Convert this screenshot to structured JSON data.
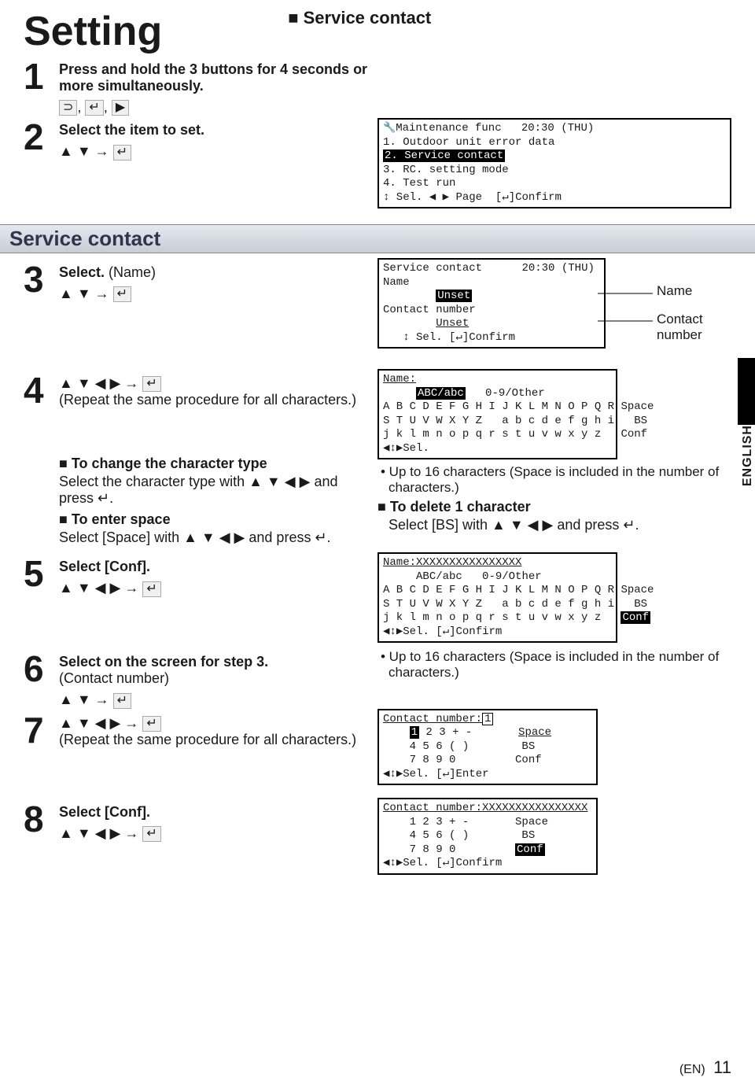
{
  "page": {
    "title": "Setting",
    "section_header": "■ Service contact",
    "section_bar": "Service contact",
    "lang_tab": "ENGLISH",
    "footer_lang": "(EN)",
    "footer_page": "11"
  },
  "steps": {
    "s1": {
      "num": "1",
      "text": "Press and hold the 3 buttons for 4 seconds or more simultaneously.",
      "icons": "⊃, ↵, ▶"
    },
    "s2": {
      "num": "2",
      "text": "Select the item to set.",
      "icons": "▲ ▼ → ↵"
    },
    "s3": {
      "num": "3",
      "text_a": "Select. ",
      "text_b": "(Name)",
      "icons": "▲ ▼ → ↵"
    },
    "s4": {
      "num": "4",
      "icons": "▲ ▼ ◀ ▶ → ↵",
      "text": "(Repeat the same procedure for all characters.)"
    },
    "s5": {
      "num": "5",
      "text": "Select [Conf].",
      "icons": "▲ ▼ ◀ ▶ → ↵"
    },
    "s6": {
      "num": "6",
      "text_a": "Select on the screen for step 3.",
      "text_b": "(Contact number)",
      "icons": "▲ ▼ → ↵"
    },
    "s7": {
      "num": "7",
      "icons": "▲ ▼ ◀ ▶ → ↵",
      "text": "(Repeat the same procedure for all characters.)"
    },
    "s8": {
      "num": "8",
      "text": "Select [Conf].",
      "icons": "▲ ▼ ◀ ▶ → ↵"
    }
  },
  "sub": {
    "change_type_h": "■ To change the character type",
    "change_type_t": "Select the character type with ▲ ▼ ◀ ▶ and press ↵.",
    "enter_space_h": "■ To enter space",
    "enter_space_t": "Select [Space] with ▲ ▼ ◀ ▶ and press ↵.",
    "note_16a": "• Up to 16 characters (Space is included in the number of characters.)",
    "delete_h": "■ To delete 1 character",
    "delete_t": "Select [BS] with ▲ ▼ ◀ ▶ and press ↵.",
    "note_16b": "• Up to 16 characters (Space is included in the number of characters.)"
  },
  "callouts": {
    "name": "Name",
    "contact": "Contact number"
  },
  "screens": {
    "maint": {
      "title_l": "Maintenance func",
      "title_r": "20:30 (THU)",
      "l1": "1. Outdoor unit error data",
      "l2": "2. Service contact",
      "l3": "3. RC. setting mode",
      "l4": "4. Test run",
      "foot": "↕ Sel. ◀ ▶ Page  [↵]Confirm"
    },
    "svc": {
      "title_l": "Service contact",
      "title_r": "20:30 (THU)",
      "name_lbl": "Name",
      "name_val": "Unset",
      "cn_lbl": "Contact number",
      "cn_val": "Unset",
      "foot": "↕ Sel. [↵]Confirm"
    },
    "name_entry": {
      "hdr": "Name:",
      "tabs_a": "ABC/abc",
      "tabs_b": "0-9/Other",
      "r1": "A B C D E F G H I J K L M N O P Q R Space",
      "r2": "S T U V W X Y Z   a b c d e f g h i   BS  ",
      "r3": "j k l m n o p q r s t u v w x y z   Conf ",
      "foot": "◀↕▶Sel."
    },
    "name_conf": {
      "hdr": "Name:XXXXXXXXXXXXXXXX",
      "tabs_a": "ABC/abc",
      "tabs_b": "0-9/Other",
      "r1": "A B C D E F G H I J K L M N O P Q R Space",
      "r2": "S T U V W X Y Z   a b c d e f g h i   BS  ",
      "r3": "j k l m n o p q r s t u v w x y z   ",
      "r3b": "Conf",
      "foot": "◀↕▶Sel. [↵]Confirm"
    },
    "num_entry": {
      "hdr": "Contact number:",
      "hdr_cursor": "1",
      "r1a": "1",
      "r1b": " 2 3 + -       ",
      "r1c": "Space",
      "r2": "4 5 6 ( )        BS  ",
      "r3": "7 8 9 0         Conf ",
      "foot": "◀↕▶Sel. [↵]Enter"
    },
    "num_conf": {
      "hdr": "Contact number:XXXXXXXXXXXXXXXX",
      "r1": "1 2 3 + -       Space",
      "r2": "4 5 6 ( )        BS  ",
      "r3a": "7 8 9 0         ",
      "r3b": "Conf",
      "foot": "◀↕▶Sel. [↵]Confirm"
    }
  }
}
